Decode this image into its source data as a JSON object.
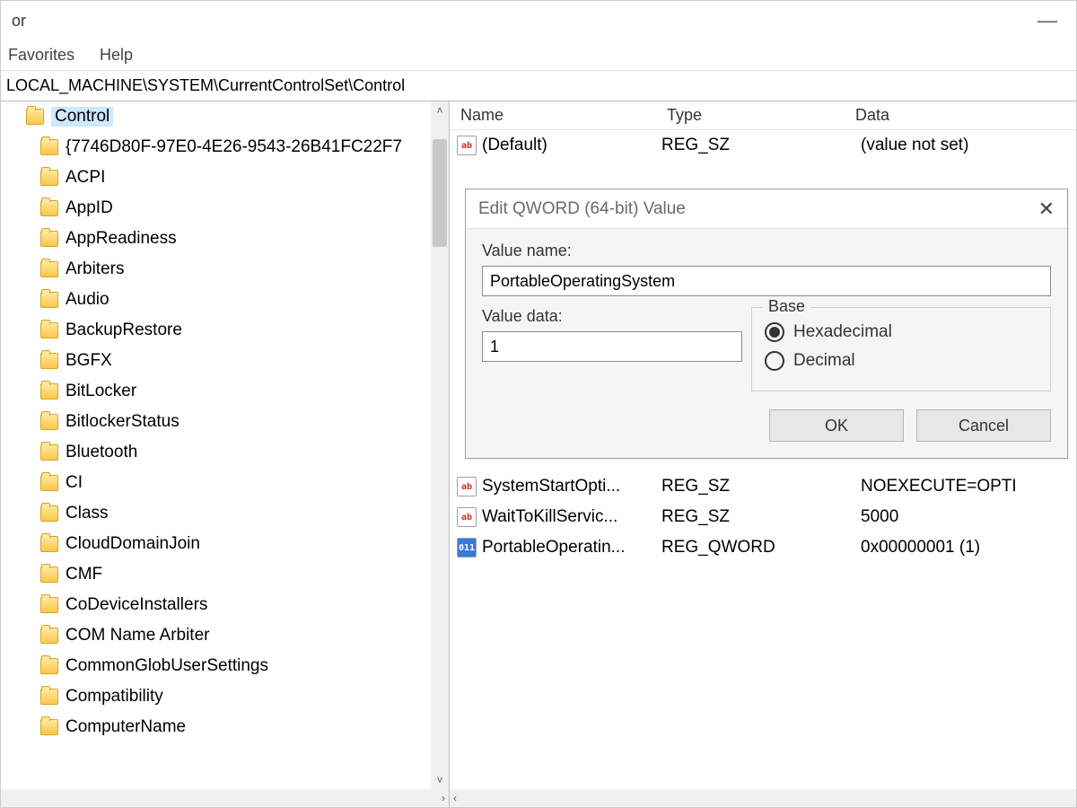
{
  "window": {
    "title_fragment": "or",
    "minimize_glyph": "—"
  },
  "menu": {
    "favorites": "Favorites",
    "help": "Help"
  },
  "address": "LOCAL_MACHINE\\SYSTEM\\CurrentControlSet\\Control",
  "tree": {
    "selected": "Control",
    "items": [
      "{7746D80F-97E0-4E26-9543-26B41FC22F7",
      "ACPI",
      "AppID",
      "AppReadiness",
      "Arbiters",
      "Audio",
      "BackupRestore",
      "BGFX",
      "BitLocker",
      "BitlockerStatus",
      "Bluetooth",
      "CI",
      "Class",
      "CloudDomainJoin",
      "CMF",
      "CoDeviceInstallers",
      "COM Name Arbiter",
      "CommonGlobUserSettings",
      "Compatibility",
      "ComputerName"
    ]
  },
  "list": {
    "columns": {
      "name": "Name",
      "type": "Type",
      "data": "Data"
    },
    "rows": [
      {
        "icon": "sz",
        "name": "(Default)",
        "type": "REG_SZ",
        "data": "(value not set)"
      },
      {
        "icon": "sz",
        "name": "SystemStartOpti...",
        "type": "REG_SZ",
        "data": "NOEXECUTE=OPTI"
      },
      {
        "icon": "sz",
        "name": "WaitToKillServic...",
        "type": "REG_SZ",
        "data": "5000"
      },
      {
        "icon": "bin",
        "name": "PortableOperatin...",
        "type": "REG_QWORD",
        "data": "0x00000001 (1)"
      }
    ]
  },
  "dialog": {
    "title": "Edit QWORD (64-bit) Value",
    "value_name_label": "Value name:",
    "value_name": "PortableOperatingSystem",
    "value_data_label": "Value data:",
    "value_data": "1",
    "base_label": "Base",
    "hex_label": "Hexadecimal",
    "dec_label": "Decimal",
    "ok": "OK",
    "cancel": "Cancel"
  }
}
